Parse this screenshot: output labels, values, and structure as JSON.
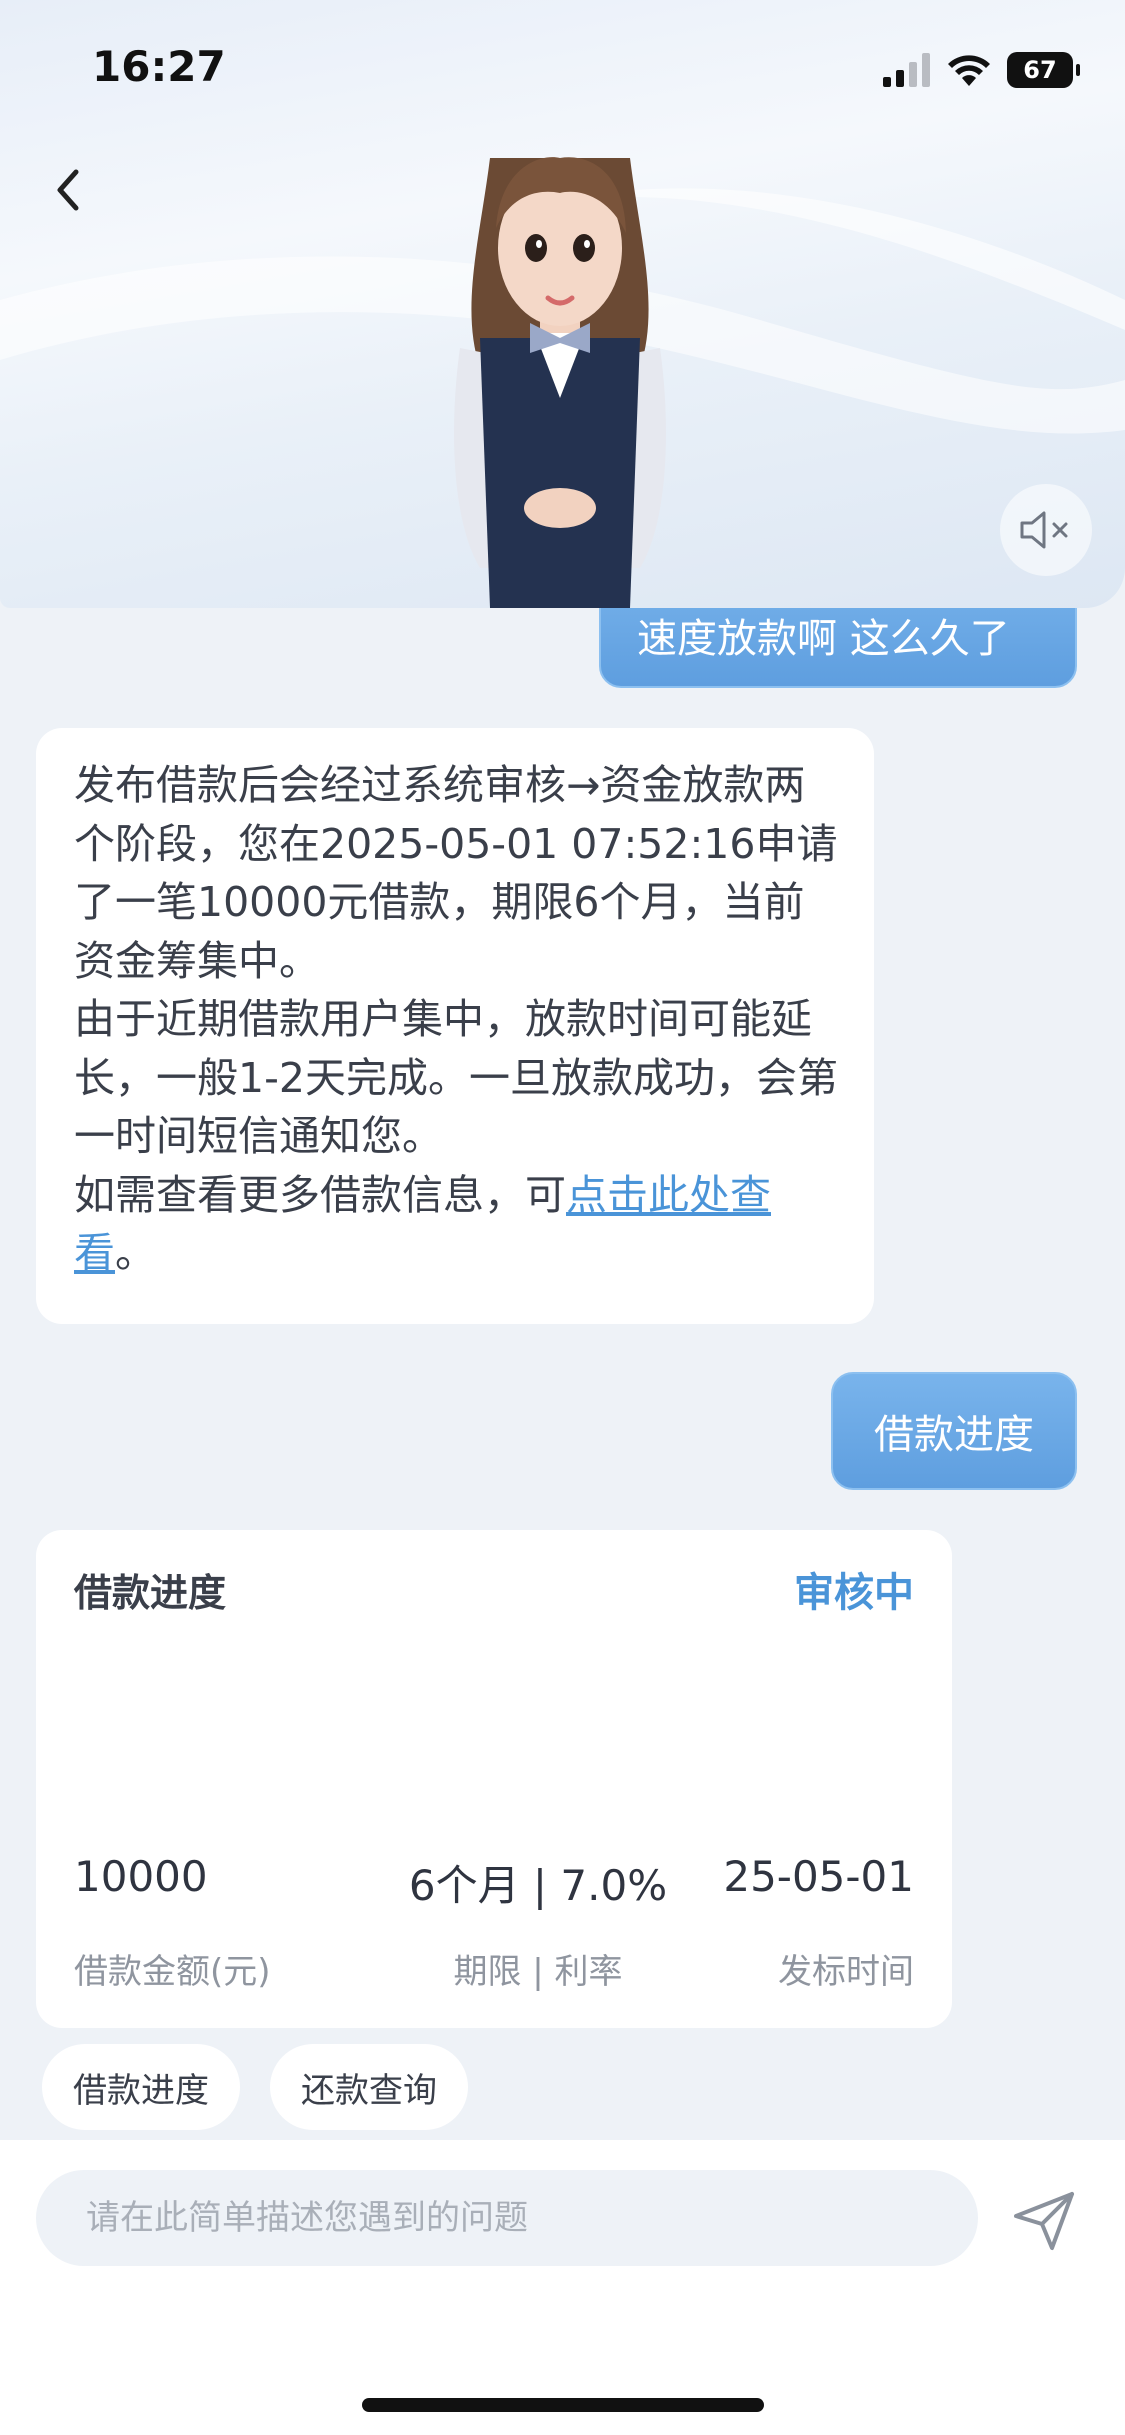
{
  "status_bar": {
    "time": "16:27",
    "battery": "67"
  },
  "messages": {
    "user_partial": "速度放款啊 这么久了",
    "bot_reply": {
      "line1": "发布借款后会经过系统审核→资金放款两个阶段，您在2025-05-01 07:52:16申请了一笔10000元借款，期限6个月，当前资金筹集中。",
      "line2": "由于近期借款用户集中，放款时间可能延长，一般1-2天完成。一旦放款成功，会第一时间短信通知您。",
      "line3_prefix": "如需查看更多借款信息，可",
      "line3_link": "点击此处查看",
      "line3_suffix": "。"
    },
    "user_progress": "借款进度"
  },
  "progress_card": {
    "title": "借款进度",
    "status": "审核中",
    "amount": "10000",
    "amount_label": "借款金额(元)",
    "term_rate": "6个月 | 7.0%",
    "term_rate_label": "期限 | 利率",
    "date": "25-05-01",
    "date_label": "发标时间"
  },
  "quick_replies": [
    "借款进度",
    "还款查询"
  ],
  "input": {
    "placeholder": "请在此简单描述您遇到的问题"
  },
  "colors": {
    "accent": "#4a94d8",
    "bubble_user": "#6aa8e6",
    "background": "#eef2f7"
  }
}
